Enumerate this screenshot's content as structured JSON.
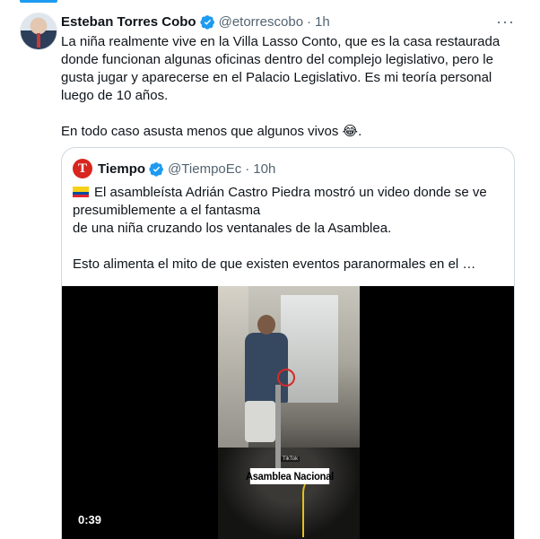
{
  "tweet": {
    "author": {
      "name": "Esteban Torres Cobo",
      "handle": "@etorrescobo",
      "time": "1h",
      "separator": "·"
    },
    "more_label": "···",
    "text_paragraph_1": "La niña realmente vive en la Villa Lasso Conto, que es la casa restaurada donde funcionan algunas oficinas dentro del complejo legislativo, pero le gusta jugar y aparecerse en el Palacio Legislativo. Es mi teoría personal luego de 10 años.",
    "text_paragraph_2": "En todo caso asusta menos que algunos vivos",
    "emoji": "😂",
    "emoji_after": "."
  },
  "quote": {
    "author": {
      "avatar_letter": "T",
      "name": "Tiempo",
      "handle": "@TiempoEc",
      "time": "10h",
      "separator": "·"
    },
    "line_1": "El asambleísta Adrián Castro Piedra mostró un video donde se ve presumiblemente a el fantasma",
    "line_2": "de una niña cruzando los ventanales de la Asamblea.",
    "line_3": "Esto alimenta el mito de que existen eventos paranormales en el …",
    "media": {
      "watermark": "Asamblea Nacional",
      "small_tag": "TikTok",
      "duration": "0:39"
    }
  },
  "colors": {
    "accent": "#1d9bf0",
    "verified_badge": "#1d9bf0",
    "secondary_text": "#536471"
  },
  "icons": [
    "verified-badge-icon",
    "more-options-icon",
    "ecuador-flag-icon"
  ]
}
